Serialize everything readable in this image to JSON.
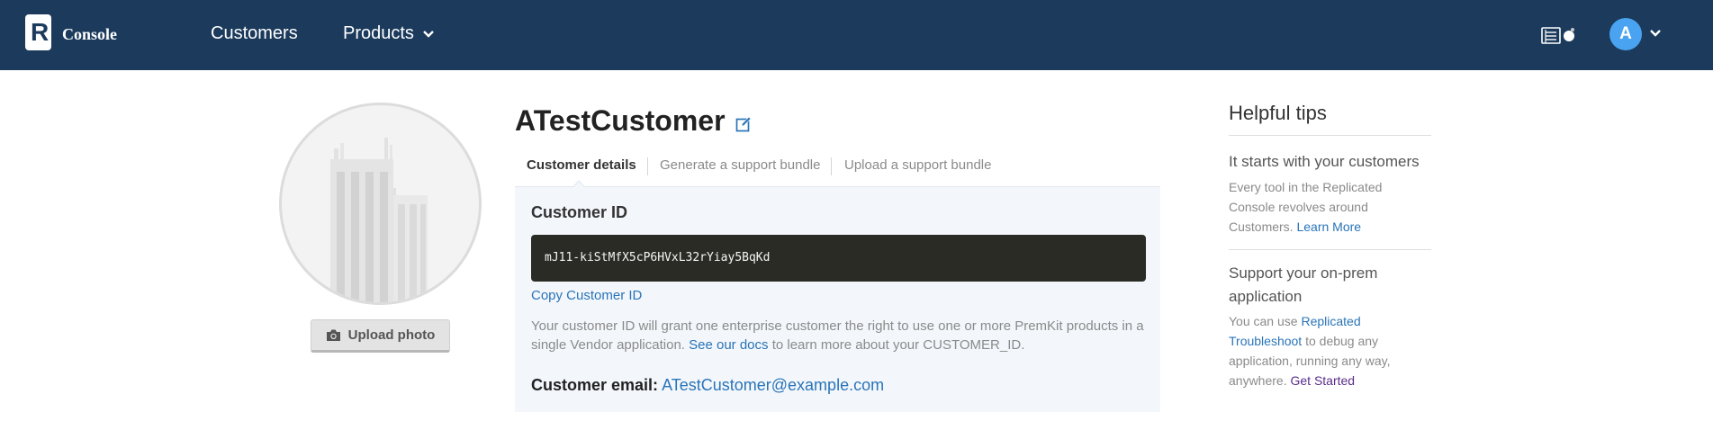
{
  "header": {
    "logo_letter": "R",
    "app_name": "Console",
    "nav": {
      "customers": "Customers",
      "products": "Products"
    },
    "user_initial": "A"
  },
  "profile": {
    "upload_photo_label": "Upload photo"
  },
  "customer": {
    "name": "ATestCustomer",
    "tabs": [
      "Customer details",
      "Generate a support bundle",
      "Upload a support bundle"
    ],
    "customer_id_label": "Customer ID",
    "customer_id": "mJ11-kiStMfX5cP6HVxL32rYiay5BqKd",
    "copy_label": "Copy Customer ID",
    "desc_text_1": "Your customer ID will grant one enterprise customer the right to use one or more PremKit products in a single Vendor application.",
    "desc_link": "See our docs",
    "desc_text_2": "to learn more about your CUSTOMER_ID.",
    "email_label": "Customer email:",
    "email": "ATestCustomer@example.com"
  },
  "tips": {
    "title": "Helpful tips",
    "tip1": {
      "heading": "It starts with your customers",
      "body": "Every tool in the Replicated Console revolves around Customers.",
      "link": "Learn More"
    },
    "tip2": {
      "heading": "Support your on-prem application",
      "body_1": "You can use",
      "link_1": "Replicated Troubleshoot",
      "body_2": "to debug any application, running any way, anywhere.",
      "link_2": "Get Started"
    }
  },
  "colors": {
    "header_bg": "#1b3a5c",
    "link": "#2a74b8",
    "avatar": "#4aa3f0",
    "code_bg": "#2b2b25",
    "panel_bg": "#f3f7fb"
  },
  "icons": [
    "logo-icon",
    "chevron-down-icon",
    "notifications-icon",
    "camera-icon",
    "edit-icon",
    "building-placeholder-icon"
  ]
}
